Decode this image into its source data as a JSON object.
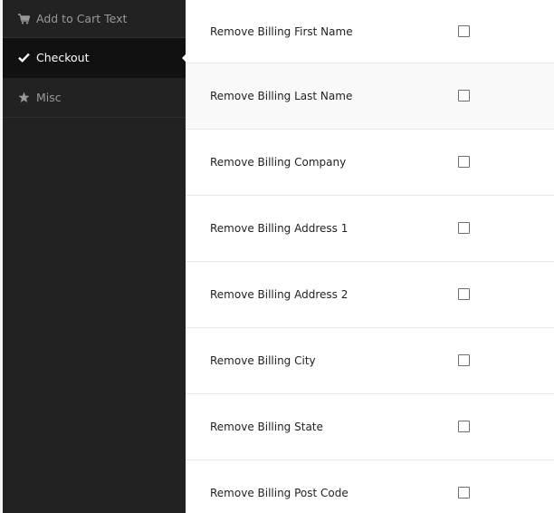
{
  "sidebar": {
    "items": [
      {
        "label": "Add to Cart Text",
        "icon": "cart-icon",
        "active": false
      },
      {
        "label": "Checkout",
        "icon": "checkmark-icon",
        "active": true
      },
      {
        "label": "Misc",
        "icon": "star-icon",
        "active": false
      }
    ]
  },
  "settings": {
    "rows": [
      {
        "label": "Remove Billing First Name",
        "checked": false
      },
      {
        "label": "Remove Billing Last Name",
        "checked": false
      },
      {
        "label": "Remove Billing Company",
        "checked": false
      },
      {
        "label": "Remove Billing Address 1",
        "checked": false
      },
      {
        "label": "Remove Billing Address 2",
        "checked": false
      },
      {
        "label": "Remove Billing City",
        "checked": false
      },
      {
        "label": "Remove Billing State",
        "checked": false
      },
      {
        "label": "Remove Billing Post Code",
        "checked": false
      }
    ]
  },
  "colors": {
    "sidebar_bg": "#222222",
    "sidebar_active_bg": "#111111",
    "sidebar_text": "#999999",
    "row_text": "#222222"
  }
}
